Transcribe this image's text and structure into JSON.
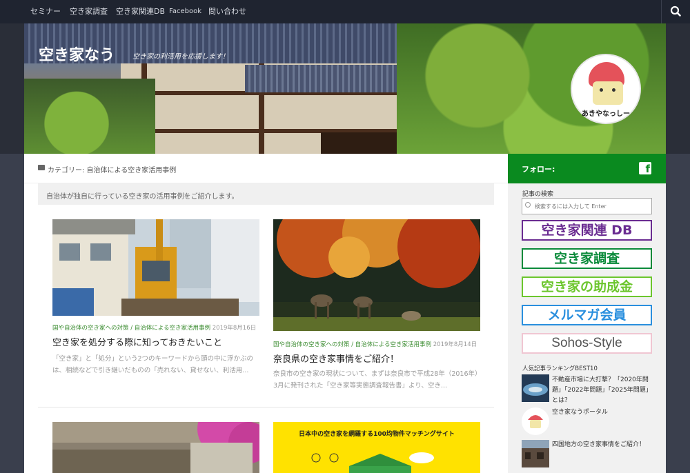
{
  "nav": {
    "items": [
      "セミナー",
      "空き家調査",
      "空き家関連DB",
      "Facebook",
      "問い合わせ"
    ]
  },
  "header": {
    "title": "空き家なう",
    "tagline": "空き家の利活用を応援します！",
    "mascot_label": "あきやなっしー"
  },
  "category": {
    "label": "カテゴリー: 自治体による空き家活用事例",
    "description": "自治体が独自に行っている空き家の活用事例をご紹介します。"
  },
  "posts": [
    {
      "cat1": "国や自治体の空き家への対策",
      "cat2": "自治体による空き家活用事例",
      "date": "2019年8月16日",
      "title": "空き家を処分する際に知っておきたいこと",
      "excerpt": "「空き家」と「処分」という2つのキーワードから頭の中に浮かぶのは、相続などで引き継いだものの「売れない、貸せない、利活用..."
    },
    {
      "cat1": "国や自治体の空き家への対策",
      "cat2": "自治体による空き家活用事例",
      "date": "2019年8月14日",
      "title": "奈良県の空き家事情をご紹介！",
      "excerpt": "奈良市の空き家の現状について、まずは奈良市で平成28年（2016年）3月に発刊された「空き家等実態調査報告書」より、空き..."
    }
  ],
  "promo_card": {
    "text": "日本中の空き家を網羅する100均物件マッチングサイト"
  },
  "sidebar": {
    "follow_label": "フォロー:",
    "search_label": "記事の検索",
    "search_placeholder": "検索するには入力して Enter",
    "banners": [
      {
        "label": "空き家関連 DB",
        "color": "#6a2c91"
      },
      {
        "label": "空き家調査",
        "color": "#0a8a3a"
      },
      {
        "label": "空き家の助成金",
        "color": "#6cc62d"
      },
      {
        "label": "メルマガ会員",
        "color": "#2a8fde"
      },
      {
        "label": "Sohos-Style",
        "color": "#e07a9a"
      }
    ],
    "ranking_label": "人気記事ランキングBEST10",
    "ranking": [
      "不動産市場に大打撃？「2020年問題」「2022年問題」「2025年問題」とは？",
      "空き家なうポータル",
      "四国地方の空き家事情をご紹介！"
    ]
  },
  "colors": {
    "nav_bg": "#1f2430",
    "accent_green": "#0a8a1f",
    "category_link": "#3a8b2f"
  }
}
